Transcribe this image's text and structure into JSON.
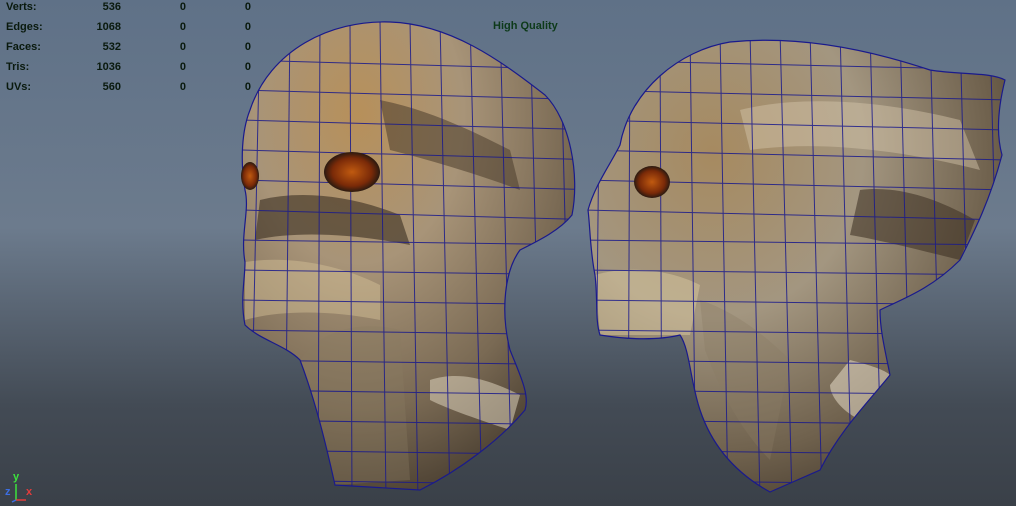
{
  "hud": {
    "rows": [
      {
        "label": "Verts:",
        "v1": "536",
        "v2": "0",
        "v3": "0"
      },
      {
        "label": "Edges:",
        "v1": "1068",
        "v2": "0",
        "v3": "0"
      },
      {
        "label": "Faces:",
        "v1": "532",
        "v2": "0",
        "v3": "0"
      },
      {
        "label": "Tris:",
        "v1": "1036",
        "v2": "0",
        "v3": "0"
      },
      {
        "label": "UVs:",
        "v1": "560",
        "v2": "0",
        "v3": "0"
      }
    ],
    "quality": "High Quality"
  },
  "axis": {
    "y": "y",
    "x": "x",
    "z": "z"
  },
  "colors": {
    "hud_text": "#0a1a0e",
    "quality_text": "#0d3a1a",
    "wireframe": "#1a1a8c",
    "skin_light": "#b8a88a",
    "skin_dark": "#5a4a36",
    "eye": "#a0400c",
    "axis_x": "#e23c3c",
    "axis_y": "#3ce23c",
    "axis_z": "#3c6ee2"
  }
}
